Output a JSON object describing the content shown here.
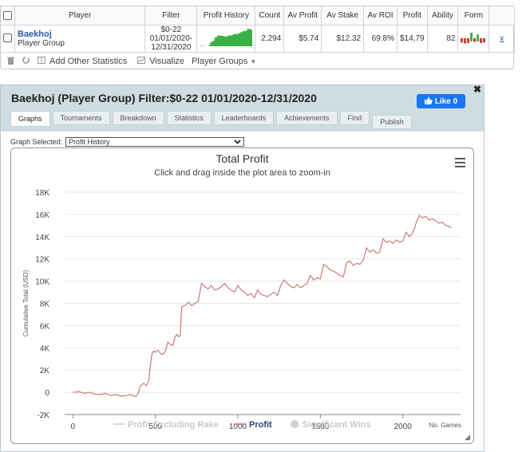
{
  "table": {
    "headers": [
      "Player",
      "Filter",
      "Profit History",
      "Count",
      "Av Profit",
      "Av Stake",
      "Av ROI",
      "Profit",
      "Ability",
      "Form"
    ],
    "row": {
      "player_name": "Baekhoj",
      "player_type": "Player Group",
      "filter_line1": "$0-22",
      "filter_line2": "01/01/2020-",
      "filter_line3": "12/31/2020",
      "count": "2,294",
      "av_profit": "$5.74",
      "av_stake": "$12.32",
      "av_roi": "69.8%",
      "profit": "$14,79",
      "ability": "82",
      "remove": "x"
    },
    "spark_color": "#3cb043",
    "form_bars": [
      {
        "v": 0.5,
        "c": "#c94040"
      },
      {
        "v": 0.7,
        "c": "#c94040"
      },
      {
        "v": 0.6,
        "c": "#c94040"
      },
      {
        "v": 1.0,
        "c": "#4caf50"
      },
      {
        "v": 0.4,
        "c": "#c94040"
      },
      {
        "v": 0.8,
        "c": "#4caf50"
      },
      {
        "v": 0.6,
        "c": "#c94040"
      },
      {
        "v": 0.5,
        "c": "#c94040"
      }
    ]
  },
  "toolbar": {
    "add_stats": "Add Other Statistics",
    "visualize": "Visualize",
    "player_groups": "Player Groups"
  },
  "window": {
    "title": "Baekhoj (Player Group) Filter:$0-22 01/01/2020-12/31/2020",
    "like_label": "Like 0",
    "tabs": [
      "Graphs",
      "Tournaments",
      "Breakdown",
      "Statistics",
      "Leaderboards",
      "Achievements",
      "Find",
      "Publish"
    ],
    "active_tab": "Graphs",
    "graph_selected_label": "Graph Selected:",
    "graph_selected_value": "Profit History"
  },
  "chart_data": {
    "type": "line",
    "title": "Total Profit",
    "subtitle": "Click and drag inside the plot area to zoom-in",
    "xlabel": "No. Games",
    "ylabel": "Cumulative Total (USD)",
    "xlim": [
      -50,
      2350
    ],
    "ylim": [
      -2000,
      18000
    ],
    "xticks": [
      0,
      500,
      1000,
      1500,
      2000
    ],
    "xtick_labels": [
      "0",
      "500",
      "1000",
      "1500",
      "2000"
    ],
    "yticks": [
      -2000,
      0,
      2000,
      4000,
      6000,
      8000,
      10000,
      12000,
      14000,
      16000,
      18000
    ],
    "ytick_labels": [
      "-2K",
      "0",
      "2K",
      "4K",
      "6K",
      "8K",
      "10K",
      "12K",
      "14K",
      "16K",
      "18K"
    ],
    "color": "#c97a7a",
    "legend": [
      "Profit Excluding Rake",
      "Profit",
      "Significant Wins"
    ],
    "legend_position": "bottom",
    "series": [
      {
        "name": "Profit",
        "x": [
          0,
          40,
          70,
          100,
          130,
          160,
          200,
          230,
          260,
          290,
          320,
          350,
          380,
          395,
          410,
          430,
          445,
          460,
          470,
          480,
          490,
          500,
          515,
          530,
          545,
          560,
          575,
          590,
          605,
          620,
          630,
          640,
          650,
          660,
          680,
          700,
          720,
          740,
          760,
          780,
          800,
          820,
          840,
          860,
          880,
          900,
          920,
          940,
          960,
          980,
          1000,
          1020,
          1040,
          1060,
          1080,
          1100,
          1120,
          1140,
          1160,
          1180,
          1200,
          1220,
          1240,
          1260,
          1280,
          1300,
          1320,
          1340,
          1360,
          1380,
          1400,
          1420,
          1440,
          1460,
          1480,
          1500,
          1520,
          1540,
          1560,
          1580,
          1600,
          1620,
          1640,
          1660,
          1680,
          1700,
          1720,
          1740,
          1760,
          1780,
          1800,
          1820,
          1840,
          1860,
          1880,
          1900,
          1920,
          1940,
          1960,
          1980,
          2000,
          2020,
          2040,
          2060,
          2080,
          2100,
          2120,
          2140,
          2160,
          2180,
          2200,
          2220,
          2240,
          2260,
          2280,
          2294
        ],
        "y": [
          0,
          50,
          -100,
          0,
          -150,
          -200,
          -100,
          -300,
          -200,
          -350,
          -300,
          -200,
          -400,
          -150,
          600,
          800,
          600,
          1000,
          2500,
          3500,
          3700,
          3600,
          3800,
          3500,
          3400,
          3700,
          4500,
          4300,
          4200,
          5000,
          5200,
          5000,
          5100,
          7700,
          7800,
          8100,
          7800,
          8000,
          8200,
          9800,
          9500,
          9300,
          9600,
          9200,
          9300,
          9500,
          9800,
          9400,
          9200,
          9000,
          9600,
          9200,
          9000,
          8700,
          8900,
          8500,
          9200,
          8800,
          8700,
          8600,
          8800,
          9000,
          8700,
          9600,
          10100,
          9800,
          9500,
          9400,
          9700,
          9400,
          9600,
          9800,
          10500,
          10100,
          10300,
          10200,
          11500,
          11300,
          11000,
          10900,
          10700,
          10500,
          10400,
          11700,
          11800,
          11400,
          11600,
          11500,
          11900,
          13000,
          12600,
          12800,
          12500,
          12600,
          13800,
          13500,
          13600,
          13400,
          13700,
          13500,
          13600,
          14400,
          14000,
          14300,
          15200,
          15900,
          15700,
          15800,
          15500,
          15600,
          15400,
          15200,
          15300,
          15000,
          14900,
          14800
        ]
      }
    ]
  }
}
